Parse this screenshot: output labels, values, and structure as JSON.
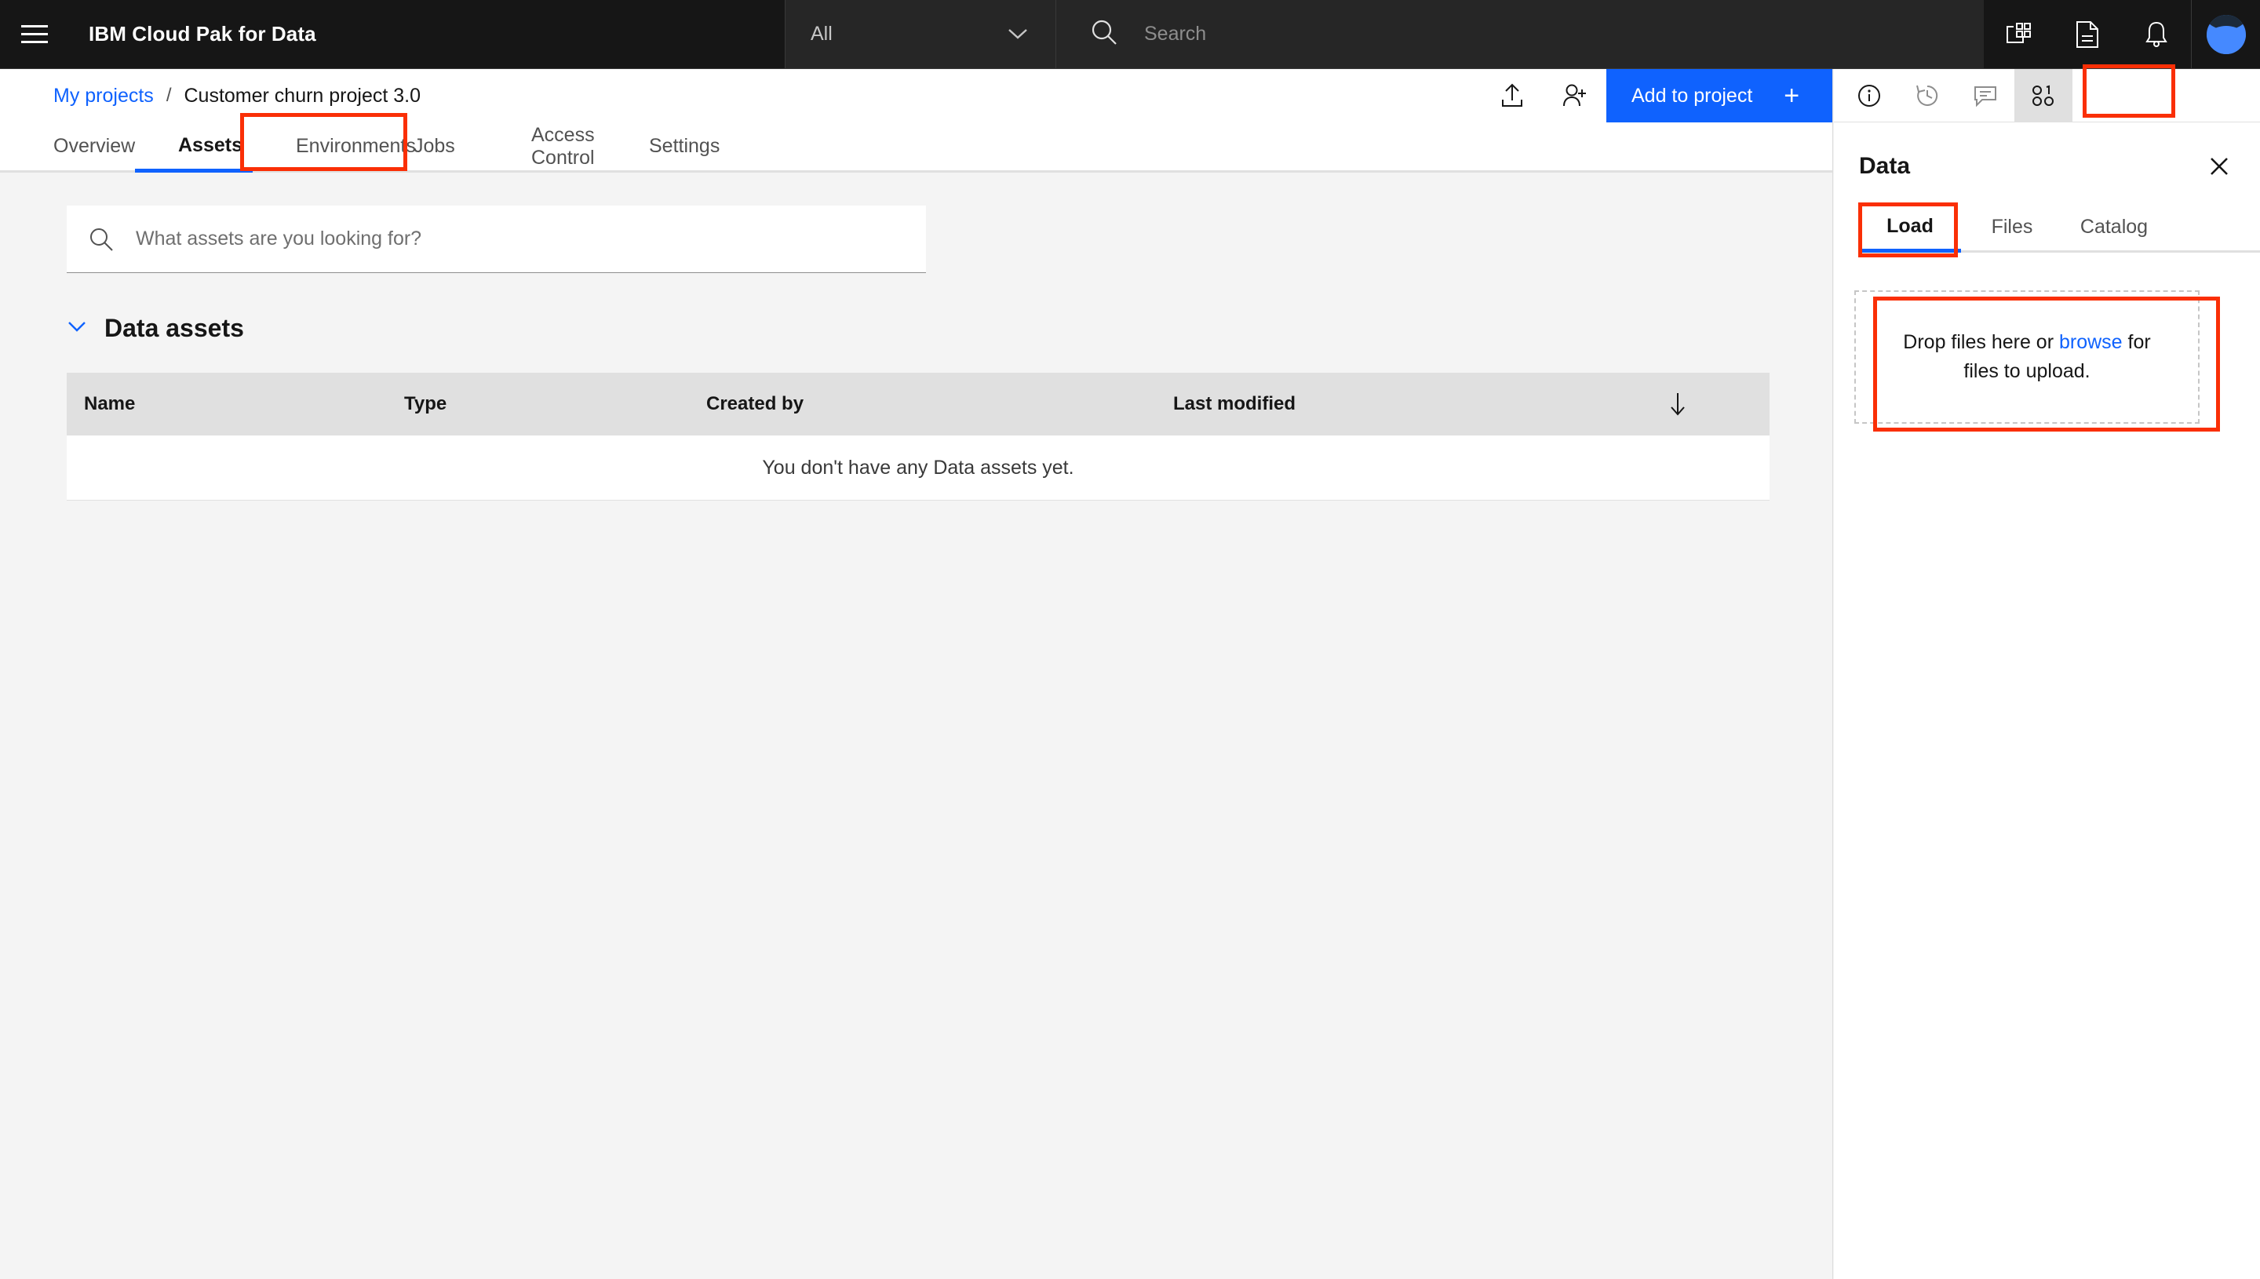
{
  "header": {
    "menu_icon": "hamburger-menu-icon",
    "brand": "IBM Cloud Pak for Data",
    "scope_selected": "All",
    "scope_options": [
      "All"
    ],
    "search_placeholder": "Search",
    "search_value": "",
    "icons": [
      "app-switcher-icon",
      "document-icon",
      "notification-bell-icon",
      "user-avatar"
    ],
    "colors": {
      "bar": "#161616",
      "field": "#262626"
    }
  },
  "breadcrumb": {
    "parent": "My projects",
    "separator": "/",
    "current": "Customer churn project 3.0",
    "upload_icon": "upload-icon",
    "add_user_icon": "add-user-icon",
    "add_button_label": "Add to project",
    "add_button_plus": "+",
    "accent": "#0f62fe"
  },
  "tabs": [
    {
      "label": "Overview",
      "active": false
    },
    {
      "label": "Assets",
      "active": true
    },
    {
      "label": "Environments",
      "active": false
    },
    {
      "label": "Jobs",
      "active": false
    },
    {
      "label": "Access Control",
      "active": false
    },
    {
      "label": "Settings",
      "active": false
    }
  ],
  "main": {
    "search_placeholder": "What assets are you looking for?",
    "search_value": "",
    "section_title": "Data assets",
    "section_expanded": true,
    "table": {
      "columns": [
        "Name",
        "Type",
        "Created by",
        "Last modified"
      ],
      "sort_icon": "sort-descending-arrow-icon",
      "rows": [],
      "empty_message": "You don't have any Data assets yet."
    }
  },
  "right_panel": {
    "icon_tabs": [
      {
        "name": "info-icon",
        "selected": false
      },
      {
        "name": "history-icon",
        "selected": false
      },
      {
        "name": "comment-icon",
        "selected": false
      },
      {
        "name": "data-binary-icon",
        "selected": true
      }
    ],
    "title": "Data",
    "close_icon": "close-icon",
    "tabs": [
      {
        "label": "Load",
        "active": true
      },
      {
        "label": "Files",
        "active": false
      },
      {
        "label": "Catalog",
        "active": false
      }
    ],
    "dropzone": {
      "text_before": "Drop files here or ",
      "link": "browse",
      "text_after": " for files to upload."
    }
  },
  "annotations": {
    "color": "#fa2f06",
    "boxes": [
      "assets-tab",
      "right-panel-data-icon",
      "load-tab",
      "upload-dropzone"
    ]
  }
}
